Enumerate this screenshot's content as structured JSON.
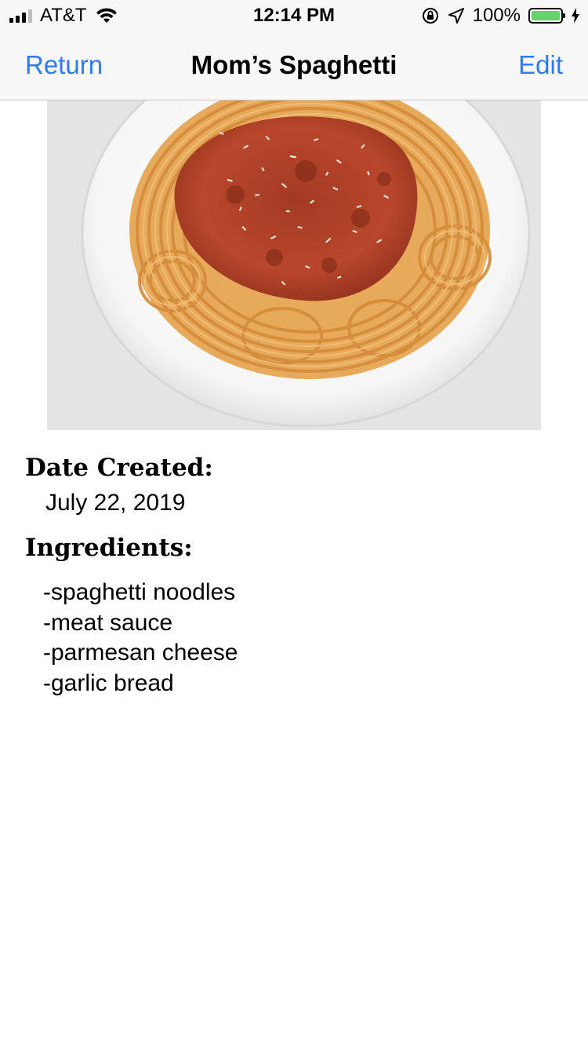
{
  "status_bar": {
    "carrier": "AT&T",
    "time": "12:14 PM",
    "battery_percent": "100%",
    "battery_level": 1.0,
    "battery_color": "#63d46b"
  },
  "nav": {
    "back_label": "Return",
    "title": "Mom’s Spaghetti",
    "edit_label": "Edit",
    "accent_color": "#2f7bf5"
  },
  "recipe": {
    "image_icon": "spaghetti-photo",
    "date_label": "Date Created:",
    "date_value": "July 22, 2019",
    "ingredients_label": "Ingredients:",
    "ingredients": [
      "-spaghetti noodles",
      "-meat sauce",
      "-parmesan cheese",
      "-garlic bread"
    ]
  }
}
